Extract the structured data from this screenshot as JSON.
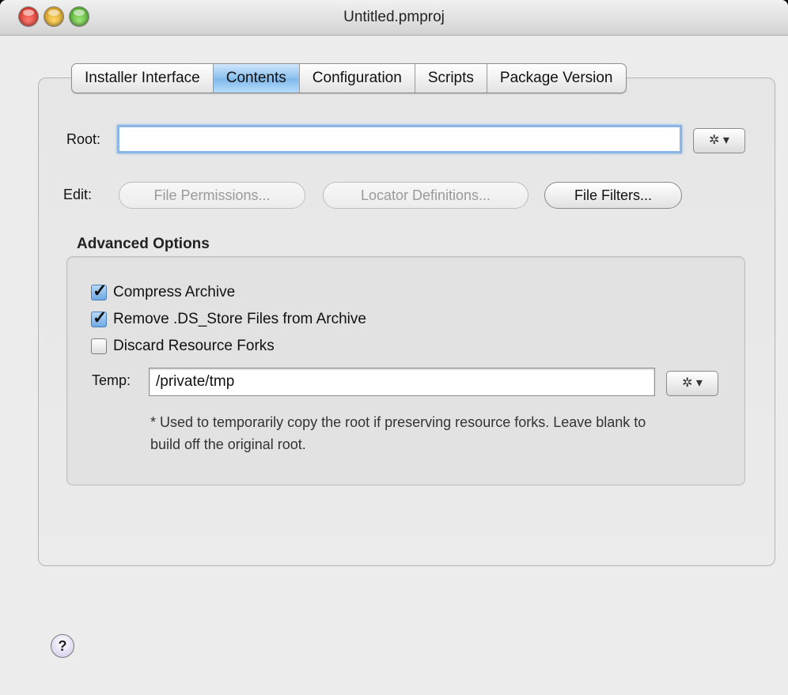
{
  "window": {
    "title": "Untitled.pmproj"
  },
  "tabs": [
    {
      "label": "Installer Interface",
      "active": false
    },
    {
      "label": "Contents",
      "active": true
    },
    {
      "label": "Configuration",
      "active": false
    },
    {
      "label": "Scripts",
      "active": false
    },
    {
      "label": "Package Version",
      "active": false
    }
  ],
  "root": {
    "label": "Root:",
    "value": "",
    "action_icon": "gear-dropdown-icon",
    "action_glyph": "✲ ▾"
  },
  "edit": {
    "label": "Edit:",
    "buttons": [
      {
        "label": "File Permissions...",
        "enabled": false
      },
      {
        "label": "Locator Definitions...",
        "enabled": false
      },
      {
        "label": "File Filters...",
        "enabled": true
      }
    ]
  },
  "advanced": {
    "title": "Advanced Options",
    "options": [
      {
        "label": "Compress Archive",
        "checked": true
      },
      {
        "label": "Remove .DS_Store Files from Archive",
        "checked": true
      },
      {
        "label": "Discard Resource Forks",
        "checked": false
      }
    ],
    "temp": {
      "label": "Temp:",
      "value": "/private/tmp",
      "action_glyph": "✲ ▾"
    },
    "note": "* Used to temporarily copy the root if preserving resource forks.  Leave blank to build off the original root."
  },
  "help": {
    "glyph": "?"
  }
}
